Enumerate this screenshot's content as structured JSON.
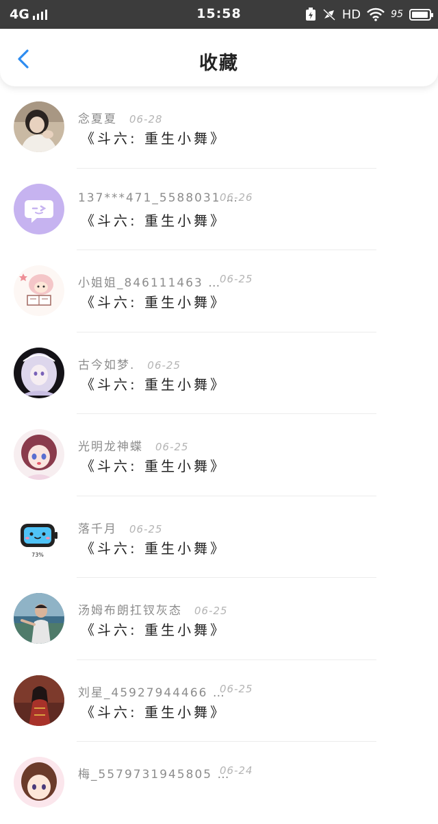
{
  "status_bar": {
    "network": "4G",
    "time": "15:58",
    "hd": "HD",
    "battery_text": "95",
    "battery_level": 0.95,
    "icons": [
      "signal-icon",
      "charging-icon",
      "mute-icon",
      "wifi-icon",
      "battery-icon"
    ]
  },
  "header": {
    "title": "收藏",
    "back_icon": "chevron-left-icon",
    "accent_color": "#2d8cf0"
  },
  "favorites": [
    {
      "user": "念夏夏",
      "date": "06-28",
      "title": "《斗六: 重生小舞》",
      "avatar": "photo-girl"
    },
    {
      "user": "137***471_5588031 …",
      "date": "06-26",
      "title": "《斗六: 重生小舞》",
      "avatar": "default-chat-bubble"
    },
    {
      "user": "小姐姐_846111463 …",
      "date": "06-25",
      "title": "《斗六: 重生小舞》",
      "avatar": "cartoon-reading"
    },
    {
      "user": "古今如梦.",
      "date": "06-25",
      "title": "《斗六: 重生小舞》",
      "avatar": "anime-white-hair"
    },
    {
      "user": "光明龙神蝶",
      "date": "06-25",
      "title": "《斗六: 重生小舞》",
      "avatar": "anime-girl-pink"
    },
    {
      "user": "落千月",
      "date": "06-25",
      "title": "《斗六: 重生小舞》",
      "avatar": "battery-robot-73"
    },
    {
      "user": "汤姆布朗扛钗灰态",
      "date": "06-25",
      "title": "《斗六: 重生小舞》",
      "avatar": "photo-man-outdoor"
    },
    {
      "user": "刘星_45927944466 …",
      "date": "06-25",
      "title": "《斗六: 重生小舞》",
      "avatar": "painting-red"
    },
    {
      "user": "梅_5579731945805 …",
      "date": "06-24",
      "title": "",
      "avatar": "anime-girl-partial"
    }
  ],
  "avatar_labels": {
    "battery_robot": "73%"
  }
}
